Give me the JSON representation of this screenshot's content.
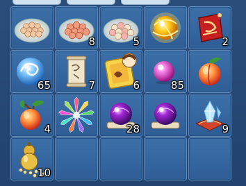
{
  "inventory": {
    "rows": [
      [
        {
          "name": "egg-plate-icon",
          "count": ""
        },
        {
          "name": "peach-bun-plate-icon",
          "count": "8"
        },
        {
          "name": "sweet-dumpling-plate-icon",
          "count": "5"
        },
        {
          "name": "golden-orb-icon",
          "count": ""
        },
        {
          "name": "red-talisman-icon",
          "count": "2"
        }
      ],
      [
        {
          "name": "swirl-pearl-icon",
          "count": "65"
        },
        {
          "name": "scroll-icon",
          "count": "7"
        },
        {
          "name": "character-card-icon",
          "count": "6"
        },
        {
          "name": "pink-pearl-icon",
          "count": "85"
        },
        {
          "name": "immortal-peach-icon",
          "count": ""
        }
      ],
      [
        {
          "name": "peach-branch-icon",
          "count": "4"
        },
        {
          "name": "rainbow-crystal-cluster-icon",
          "count": ""
        },
        {
          "name": "purple-orb-on-scroll-icon",
          "count": "28"
        },
        {
          "name": "purple-orb-on-scroll-icon",
          "count": ""
        },
        {
          "name": "crystal-on-cushion-icon",
          "count": "9"
        }
      ],
      [
        {
          "name": "gourd-with-beads-icon",
          "count": "10"
        },
        {
          "name": "empty-slot",
          "count": ""
        },
        {
          "name": "empty-slot",
          "count": ""
        },
        {
          "name": "empty-slot",
          "count": ""
        },
        {
          "name": "empty-slot",
          "count": ""
        }
      ]
    ]
  }
}
